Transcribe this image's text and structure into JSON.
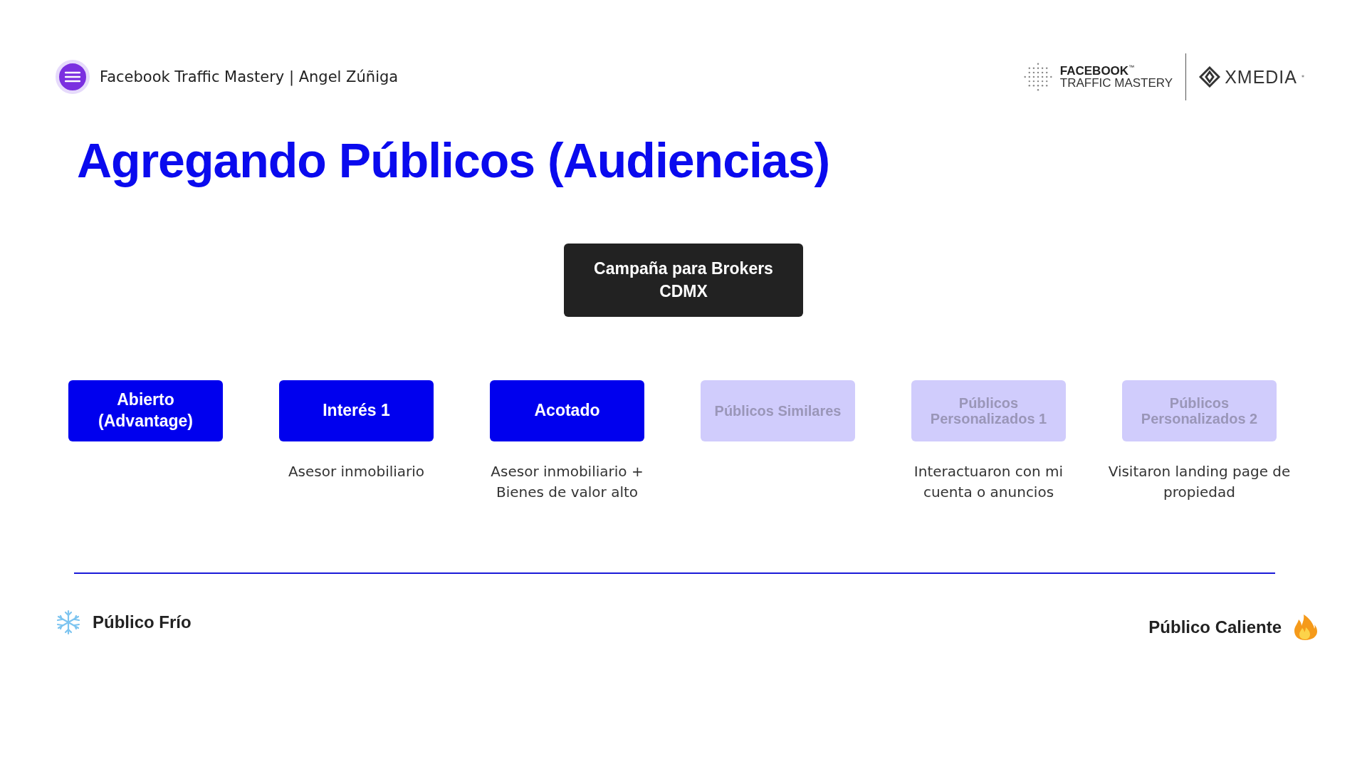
{
  "header": {
    "title": "Facebook Traffic Mastery | Angel Zúñiga"
  },
  "logos": {
    "brand_top": "FACEBOOK",
    "brand_mark": "™",
    "brand_bottom": "TRAFFIC MASTERY",
    "partner": "XMEDIA",
    "partner_mark": "*"
  },
  "slide": {
    "title": "Agregando Públicos (Audiencias)",
    "campaign": "Campaña para Brokers CDMX",
    "audiences": [
      {
        "label": "Abierto (Advantage)",
        "active": true
      },
      {
        "label": "Interés 1",
        "active": true,
        "description": "Asesor inmobiliario"
      },
      {
        "label": "Acotado",
        "active": true,
        "description": "Asesor inmobiliario + Bienes de valor alto"
      },
      {
        "label": "Públicos Similares",
        "active": false
      },
      {
        "label": "Públicos Personalizados 1",
        "active": false,
        "description": "Interactuaron con mi cuenta o anuncios"
      },
      {
        "label": "Públicos Personalizados 2",
        "active": false,
        "description": "Visitaron landing page de propiedad"
      }
    ],
    "cold": "Público Frío",
    "hot": "Público Caliente"
  }
}
